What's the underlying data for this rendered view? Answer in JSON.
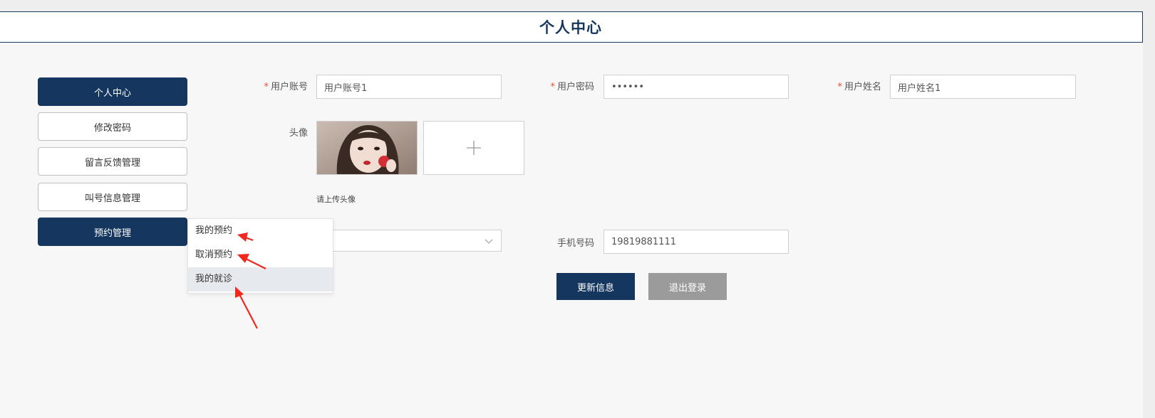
{
  "header": {
    "title": "个人中心"
  },
  "sidebar": {
    "items": [
      {
        "label": "个人中心",
        "active": true
      },
      {
        "label": "修改密码",
        "active": false
      },
      {
        "label": "留言反馈管理",
        "active": false
      },
      {
        "label": "叫号信息管理",
        "active": false
      },
      {
        "label": "预约管理",
        "active": true
      }
    ]
  },
  "dropdown": {
    "items": [
      {
        "label": "我的预约"
      },
      {
        "label": "取消预约"
      },
      {
        "label": "我的就诊",
        "highlighted": true
      }
    ]
  },
  "form": {
    "account_label": "用户账号",
    "account_value": "用户账号1",
    "password_label": "用户密码",
    "password_value": "••••••",
    "name_label": "用户姓名",
    "name_value": "用户姓名1",
    "avatar_label": "头像",
    "upload_hint": "请上传头像",
    "phone_label": "手机号码",
    "phone_value": "19819881111"
  },
  "actions": {
    "update_label": "更新信息",
    "logout_label": "退出登录"
  },
  "colors": {
    "primary": "#15375f",
    "gray_button": "#9b9b9b",
    "required": "#e74c3c",
    "annotation_arrow": "#f0281e"
  }
}
